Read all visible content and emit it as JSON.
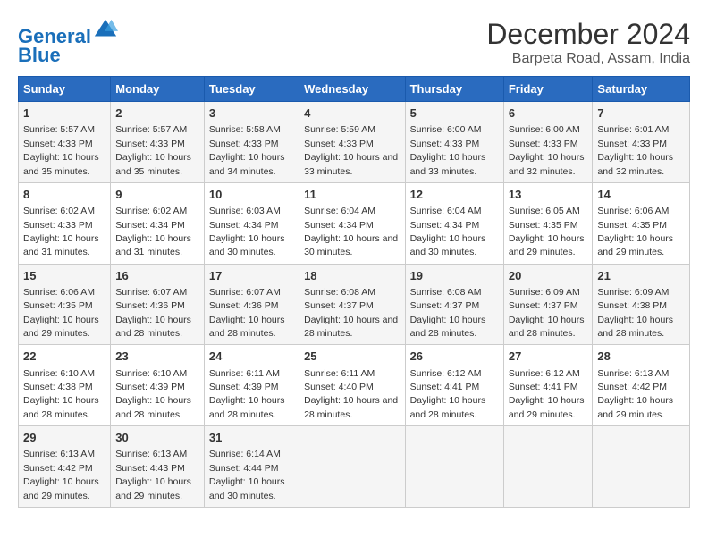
{
  "logo": {
    "line1": "General",
    "line2": "Blue"
  },
  "title": "December 2024",
  "subtitle": "Barpeta Road, Assam, India",
  "weekdays": [
    "Sunday",
    "Monday",
    "Tuesday",
    "Wednesday",
    "Thursday",
    "Friday",
    "Saturday"
  ],
  "weeks": [
    [
      {
        "day": 1,
        "sunrise": "5:57 AM",
        "sunset": "4:33 PM",
        "daylight": "10 hours and 35 minutes."
      },
      {
        "day": 2,
        "sunrise": "5:57 AM",
        "sunset": "4:33 PM",
        "daylight": "10 hours and 35 minutes."
      },
      {
        "day": 3,
        "sunrise": "5:58 AM",
        "sunset": "4:33 PM",
        "daylight": "10 hours and 34 minutes."
      },
      {
        "day": 4,
        "sunrise": "5:59 AM",
        "sunset": "4:33 PM",
        "daylight": "10 hours and 33 minutes."
      },
      {
        "day": 5,
        "sunrise": "6:00 AM",
        "sunset": "4:33 PM",
        "daylight": "10 hours and 33 minutes."
      },
      {
        "day": 6,
        "sunrise": "6:00 AM",
        "sunset": "4:33 PM",
        "daylight": "10 hours and 32 minutes."
      },
      {
        "day": 7,
        "sunrise": "6:01 AM",
        "sunset": "4:33 PM",
        "daylight": "10 hours and 32 minutes."
      }
    ],
    [
      {
        "day": 8,
        "sunrise": "6:02 AM",
        "sunset": "4:33 PM",
        "daylight": "10 hours and 31 minutes."
      },
      {
        "day": 9,
        "sunrise": "6:02 AM",
        "sunset": "4:34 PM",
        "daylight": "10 hours and 31 minutes."
      },
      {
        "day": 10,
        "sunrise": "6:03 AM",
        "sunset": "4:34 PM",
        "daylight": "10 hours and 30 minutes."
      },
      {
        "day": 11,
        "sunrise": "6:04 AM",
        "sunset": "4:34 PM",
        "daylight": "10 hours and 30 minutes."
      },
      {
        "day": 12,
        "sunrise": "6:04 AM",
        "sunset": "4:34 PM",
        "daylight": "10 hours and 30 minutes."
      },
      {
        "day": 13,
        "sunrise": "6:05 AM",
        "sunset": "4:35 PM",
        "daylight": "10 hours and 29 minutes."
      },
      {
        "day": 14,
        "sunrise": "6:06 AM",
        "sunset": "4:35 PM",
        "daylight": "10 hours and 29 minutes."
      }
    ],
    [
      {
        "day": 15,
        "sunrise": "6:06 AM",
        "sunset": "4:35 PM",
        "daylight": "10 hours and 29 minutes."
      },
      {
        "day": 16,
        "sunrise": "6:07 AM",
        "sunset": "4:36 PM",
        "daylight": "10 hours and 28 minutes."
      },
      {
        "day": 17,
        "sunrise": "6:07 AM",
        "sunset": "4:36 PM",
        "daylight": "10 hours and 28 minutes."
      },
      {
        "day": 18,
        "sunrise": "6:08 AM",
        "sunset": "4:37 PM",
        "daylight": "10 hours and 28 minutes."
      },
      {
        "day": 19,
        "sunrise": "6:08 AM",
        "sunset": "4:37 PM",
        "daylight": "10 hours and 28 minutes."
      },
      {
        "day": 20,
        "sunrise": "6:09 AM",
        "sunset": "4:37 PM",
        "daylight": "10 hours and 28 minutes."
      },
      {
        "day": 21,
        "sunrise": "6:09 AM",
        "sunset": "4:38 PM",
        "daylight": "10 hours and 28 minutes."
      }
    ],
    [
      {
        "day": 22,
        "sunrise": "6:10 AM",
        "sunset": "4:38 PM",
        "daylight": "10 hours and 28 minutes."
      },
      {
        "day": 23,
        "sunrise": "6:10 AM",
        "sunset": "4:39 PM",
        "daylight": "10 hours and 28 minutes."
      },
      {
        "day": 24,
        "sunrise": "6:11 AM",
        "sunset": "4:39 PM",
        "daylight": "10 hours and 28 minutes."
      },
      {
        "day": 25,
        "sunrise": "6:11 AM",
        "sunset": "4:40 PM",
        "daylight": "10 hours and 28 minutes."
      },
      {
        "day": 26,
        "sunrise": "6:12 AM",
        "sunset": "4:41 PM",
        "daylight": "10 hours and 28 minutes."
      },
      {
        "day": 27,
        "sunrise": "6:12 AM",
        "sunset": "4:41 PM",
        "daylight": "10 hours and 29 minutes."
      },
      {
        "day": 28,
        "sunrise": "6:13 AM",
        "sunset": "4:42 PM",
        "daylight": "10 hours and 29 minutes."
      }
    ],
    [
      {
        "day": 29,
        "sunrise": "6:13 AM",
        "sunset": "4:42 PM",
        "daylight": "10 hours and 29 minutes."
      },
      {
        "day": 30,
        "sunrise": "6:13 AM",
        "sunset": "4:43 PM",
        "daylight": "10 hours and 29 minutes."
      },
      {
        "day": 31,
        "sunrise": "6:14 AM",
        "sunset": "4:44 PM",
        "daylight": "10 hours and 30 minutes."
      },
      null,
      null,
      null,
      null
    ]
  ]
}
